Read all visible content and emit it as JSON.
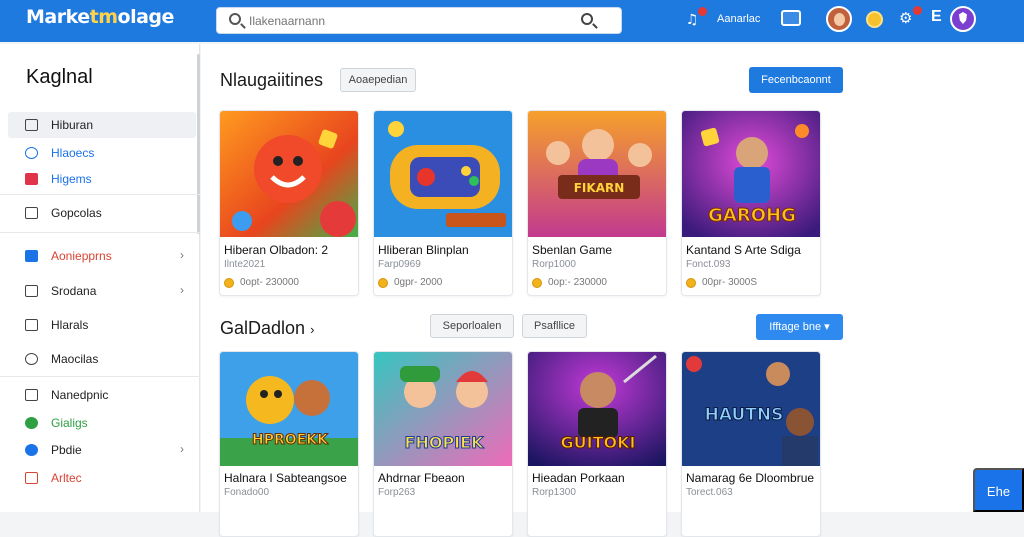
{
  "header": {
    "logo_main": "Marke",
    "logo_accent": "tm",
    "logo_tail": "olage",
    "search_placeholder": "Ilakenaarnann",
    "user_label": "Aanarlac",
    "menu_letter": "E"
  },
  "sidebar": {
    "title": "Kaglnal",
    "items": [
      {
        "label": "Hiburan",
        "icon": "list-icon",
        "active": true
      },
      {
        "label": "Hlaoecs",
        "icon": "circle-icon"
      },
      {
        "label": "Higems",
        "icon": "square-icon"
      },
      {
        "label": "Gopcolas",
        "icon": "grid-icon"
      },
      {
        "label": "Aoniepprns",
        "icon": "store-icon",
        "chevron": "›"
      },
      {
        "label": "Srodana",
        "icon": "box-icon",
        "chevron": "›"
      },
      {
        "label": "Hlarals",
        "icon": "document-icon"
      },
      {
        "label": "Maocilas",
        "icon": "chat-icon"
      },
      {
        "label": "Nanedpnic",
        "icon": "bell-icon"
      },
      {
        "label": "Gialigs",
        "icon": "globe-icon"
      },
      {
        "label": "Pbdie",
        "icon": "profile-icon",
        "chevron": "›"
      },
      {
        "label": "Arltec",
        "icon": "close-icon"
      }
    ]
  },
  "sections": [
    {
      "title": "Nlaugaiitines",
      "pill": "Aoaepedian",
      "action": "Fecenbcaonnt",
      "cards": [
        {
          "title": "Hiberan Olbadon: 2",
          "sub": "Ilnte2021",
          "meta": "0opt-  230000",
          "thumb_text": ""
        },
        {
          "title": "Hliberan Blinplan",
          "sub": "Farp0969",
          "meta": "0gpr-  2000",
          "thumb_text": ""
        },
        {
          "title": "Sbenlan Game",
          "sub": "Rorp1000",
          "meta": "0op:-  230000",
          "thumb_text": "FIKARN"
        },
        {
          "title": "Kantand S Arte Sdiga",
          "sub": "Fonct.093",
          "meta": "00pr-  3000S",
          "thumb_text": "GAROHG"
        }
      ]
    },
    {
      "title": "GalDadlon",
      "title_chevron": "›",
      "pill1": "Seporloalen",
      "pill2": "Psafllice",
      "action": "Ifftage bne",
      "action_chevron": "▾",
      "cards": [
        {
          "title": "Halnara I Sabteangsoe",
          "sub": "Fonado00",
          "meta": "",
          "thumb_text": "HPROEKK"
        },
        {
          "title": "Ahdrnar Fbeaon",
          "sub": "Forp263",
          "meta": "",
          "thumb_text": "FHOPIEK"
        },
        {
          "title": "Hieadan Porkaan",
          "sub": "Rorp1300",
          "meta": "",
          "thumb_text": "GUITOKI"
        },
        {
          "title": "Namarag 6e Dloombrue",
          "sub": "Torect.063",
          "meta": "",
          "thumb_text": "HAUTNS"
        }
      ]
    }
  ],
  "fab_label": "Ehe",
  "colors": {
    "brand": "#1f7ae0",
    "accent_blue": "#1a73e8",
    "accent_red": "#d84433",
    "accent_green": "#2ea043"
  }
}
